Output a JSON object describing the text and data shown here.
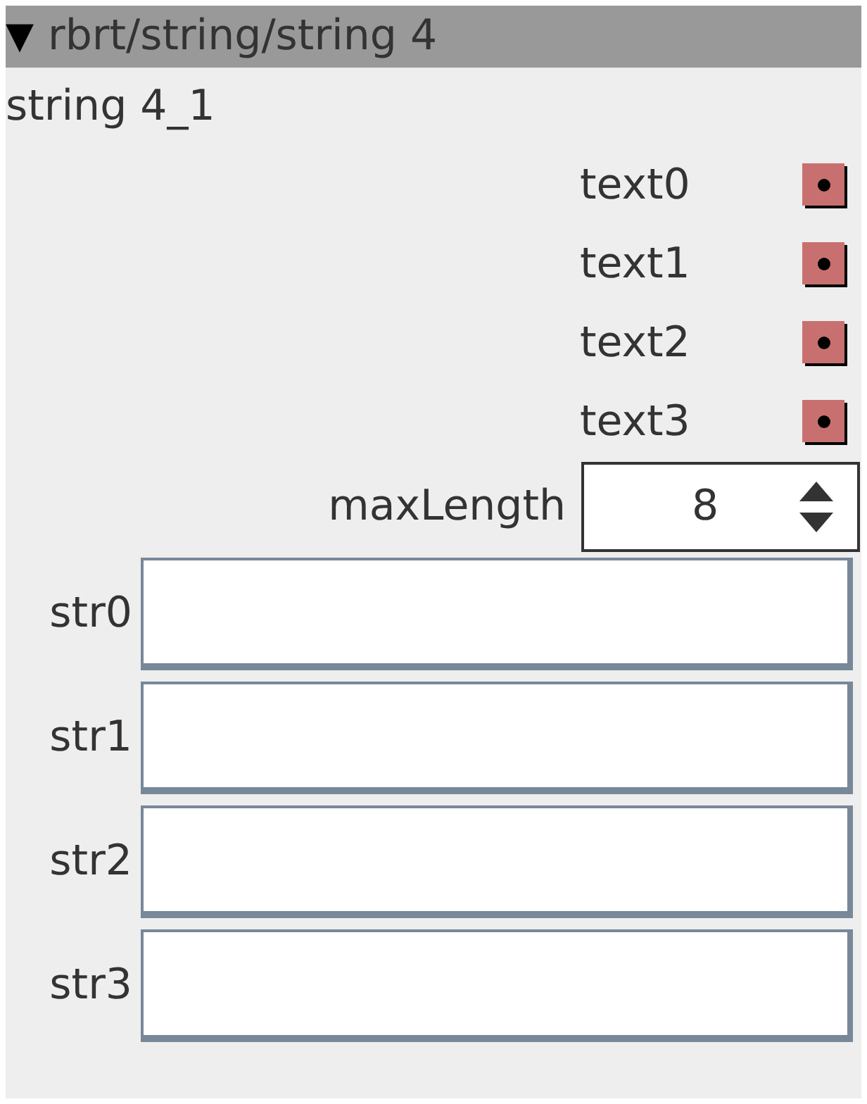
{
  "header": {
    "arrow": "▼",
    "title": "rbrt/string/string 4"
  },
  "name": "string 4_1",
  "toggles": [
    {
      "label": "text0"
    },
    {
      "label": "text1"
    },
    {
      "label": "text2"
    },
    {
      "label": "text3"
    }
  ],
  "max_length": {
    "label": "maxLength",
    "value": "8"
  },
  "fields": [
    {
      "label": "str0"
    },
    {
      "label": "str1"
    },
    {
      "label": "str2"
    },
    {
      "label": "str3"
    }
  ]
}
